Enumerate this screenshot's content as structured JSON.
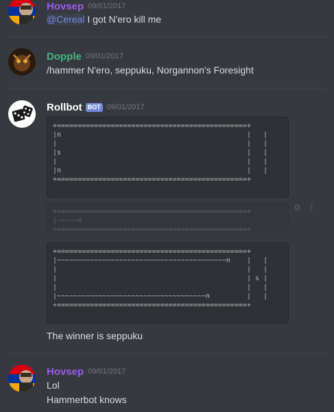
{
  "messages": [
    {
      "username": "Hovsep",
      "timestamp": "09/01/2017",
      "mention": "@Cereal",
      "text": " I got N'ero kill me",
      "color": "#9c5af0"
    },
    {
      "username": "Dopple",
      "timestamp": "09/01/2017",
      "text": "/hammer N'ero, seppuku, Norgannon's Foresight",
      "color": "#43b581"
    },
    {
      "username": "Rollbot",
      "timestamp": "09/01/2017",
      "badge": "BOT",
      "code_block_1": "+==============================================+\n|n                                             |   |\n|                                              |   |\n|s                                             |   |\n|                                              |   |\n|n                                             |   |\n+==============================================+",
      "code_block_2": "+==============================================+\n|~~~~~n\n+==============================================+",
      "code_block_3": "+==============================================+\n|~~~~~~~~~~~~~~~~~~~~~~~~~~~~~~~~~~~~~~~~~n    |   |\n|                                              |   |\n|                                              | s |\n|                                              |   |\n|~~~~~~~~~~~~~~~~~~~~~~~~~~~~~~~~~~~~n         |   |\n+==============================================+",
      "result": "The winner is seppuku",
      "color": "#ffffff"
    },
    {
      "username": "Hovsep",
      "timestamp": "09/01/2017",
      "lines": [
        "Lol",
        "Hammerbot knows"
      ],
      "color": "#9c5af0"
    }
  ],
  "hover_icons": [
    "add-reaction-icon",
    "more-options-icon"
  ]
}
